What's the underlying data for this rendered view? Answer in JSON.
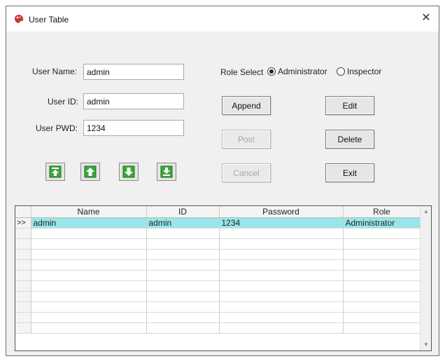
{
  "window": {
    "title": "User Table",
    "close_glyph": "✕"
  },
  "form": {
    "user_name": {
      "label": "User Name:",
      "value": "admin"
    },
    "user_id": {
      "label": "User ID:",
      "value": "admin"
    },
    "user_pwd": {
      "label": "User PWD:",
      "value": "1234"
    }
  },
  "role": {
    "label": "Role Select",
    "options": [
      {
        "label": "Administrator",
        "checked": true
      },
      {
        "label": "Inspector",
        "checked": false
      }
    ]
  },
  "buttons": {
    "append": "Append",
    "edit": "Edit",
    "post": "Post",
    "delete": "Delete",
    "cancel": "Cancel",
    "exit": "Exit"
  },
  "nav_icons": [
    "move-first-icon",
    "move-up-icon",
    "move-down-icon",
    "move-last-icon"
  ],
  "grid": {
    "columns": [
      "Name",
      "ID",
      "Password",
      "Role"
    ],
    "row_indicator": ">>",
    "rows": [
      {
        "Name": "admin",
        "ID": "admin",
        "Password": "1234",
        "Role": "Administrator"
      }
    ],
    "selected_color": "#99e6ea"
  }
}
